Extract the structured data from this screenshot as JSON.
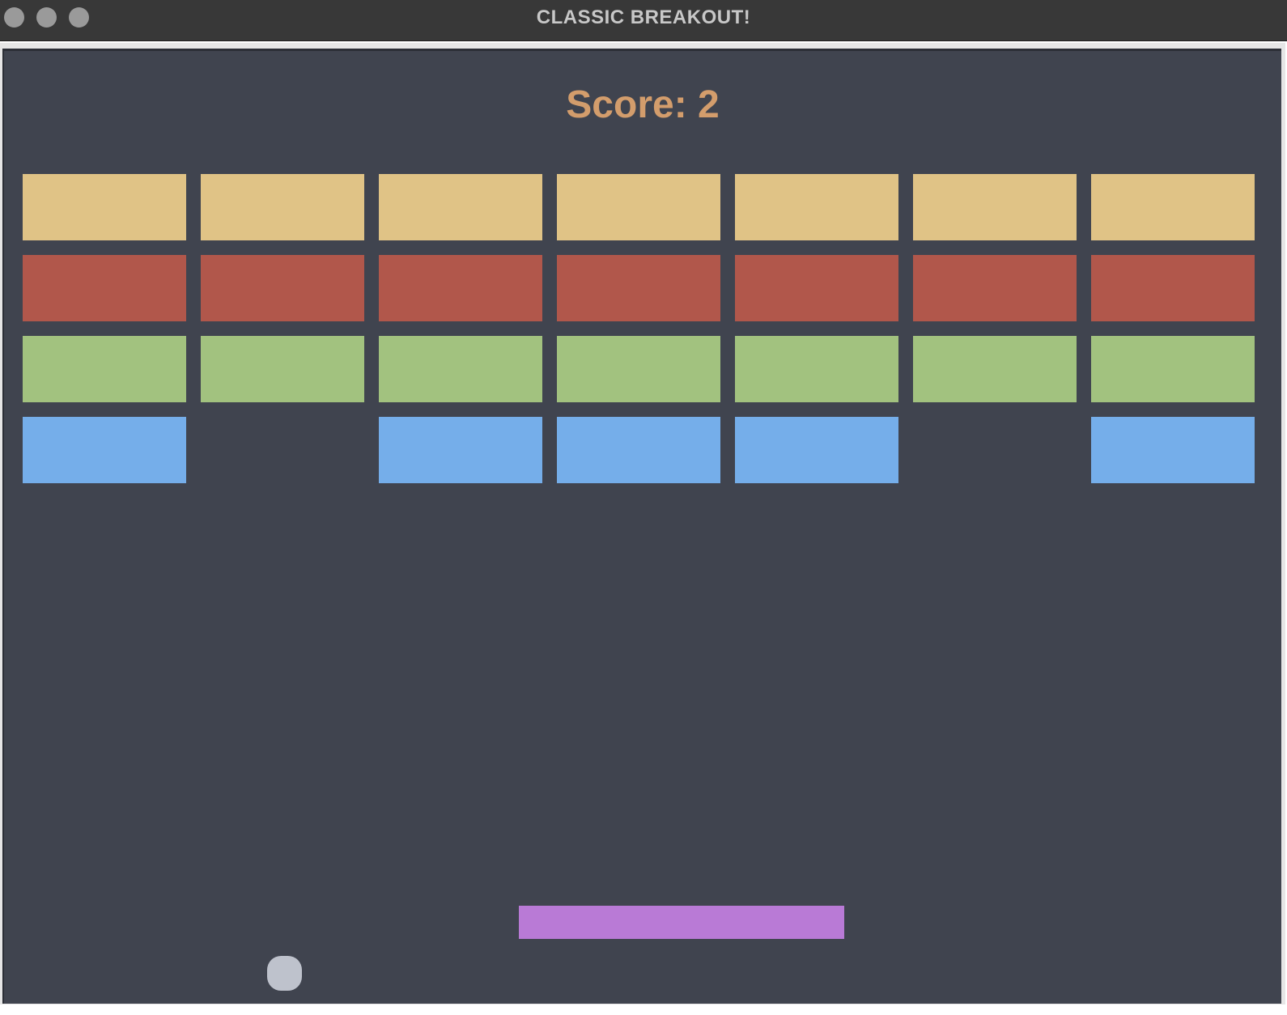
{
  "window": {
    "title": "CLASSIC BREAKOUT!"
  },
  "game": {
    "score_text": "Score: 2",
    "score": 2,
    "colors": {
      "background": "#40444f",
      "score": "#d39d6c",
      "paddle": "#b97ad6",
      "ball": "#bec2cc"
    },
    "bricks": {
      "columns": 7,
      "rows": [
        {
          "color": "#e0c386",
          "present": [
            true,
            true,
            true,
            true,
            true,
            true,
            true
          ]
        },
        {
          "color": "#b1574b",
          "present": [
            true,
            true,
            true,
            true,
            true,
            true,
            true
          ]
        },
        {
          "color": "#a2c27f",
          "present": [
            true,
            true,
            true,
            true,
            true,
            true,
            true
          ]
        },
        {
          "color": "#75aeea",
          "present": [
            true,
            false,
            true,
            true,
            true,
            false,
            true
          ]
        }
      ]
    }
  }
}
